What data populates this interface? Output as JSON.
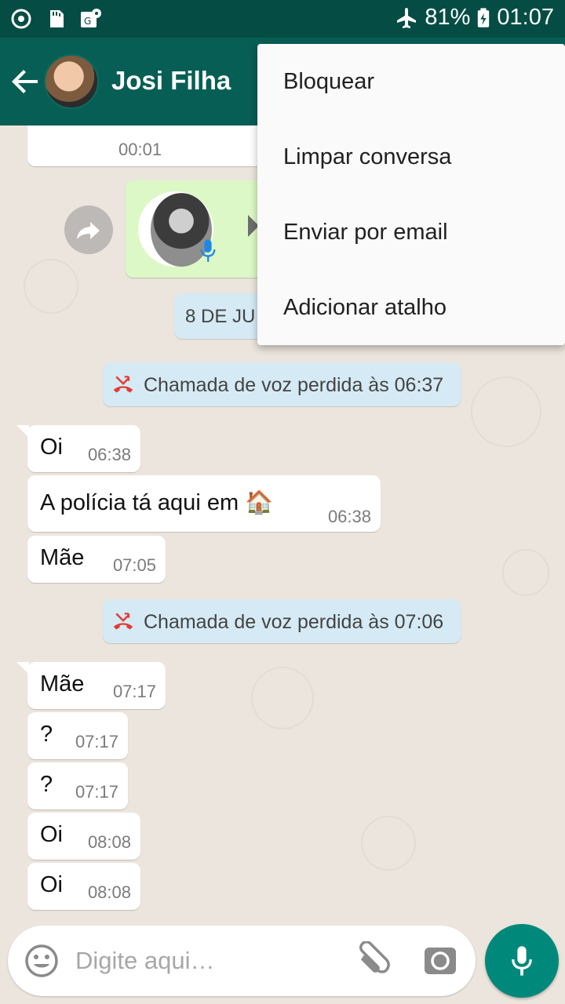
{
  "status_bar": {
    "battery": "81%",
    "time": "01:07",
    "icons": [
      "sync-icon",
      "sd-card-icon",
      "map-icon",
      "airplane-icon",
      "battery-charging-icon"
    ]
  },
  "header": {
    "contact_name": "Josi Filha",
    "back_icon": "arrow-back-icon"
  },
  "menu": {
    "items": [
      {
        "label": "Bloquear"
      },
      {
        "label": "Limpar conversa"
      },
      {
        "label": "Enviar por email"
      },
      {
        "label": "Adicionar atalho"
      }
    ]
  },
  "chat": {
    "audio_duration": "00:01",
    "date_chip": "8 DE JU",
    "missed_calls": [
      "Chamada de voz perdida às 06:37",
      "Chamada de voz perdida às 07:06"
    ],
    "messages": [
      {
        "text": "Oi",
        "time": "06:38"
      },
      {
        "text": "A polícia tá aqui em 🏠",
        "time": "06:38"
      },
      {
        "text": "Mãe",
        "time": "07:05"
      },
      {
        "text": "Mãe",
        "time": "07:17"
      },
      {
        "text": "?",
        "time": "07:17"
      },
      {
        "text": "?",
        "time": "07:17"
      },
      {
        "text": "Oi",
        "time": "08:08"
      },
      {
        "text": "Oi",
        "time": "08:08"
      }
    ]
  },
  "composer": {
    "placeholder": "Digite aqui…"
  },
  "colors": {
    "status_bar": "#054d44",
    "app_bar": "#075e54",
    "chat_bg": "#ece5dd",
    "outgoing_bubble": "#dcf8c6",
    "system_chip": "#d5eaf4",
    "mic_button": "#00897b",
    "missed_call": "#e53935"
  }
}
